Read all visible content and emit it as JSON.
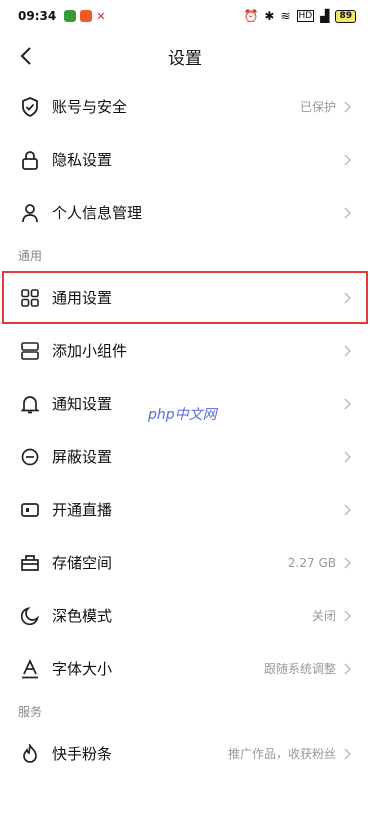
{
  "status": {
    "time": "09:34",
    "battery": "89"
  },
  "header": {
    "title": "设置"
  },
  "account": [
    {
      "label": "账号与安全",
      "value": "已保护"
    },
    {
      "label": "隐私设置",
      "value": ""
    },
    {
      "label": "个人信息管理",
      "value": ""
    }
  ],
  "general_section": "通用",
  "general": [
    {
      "label": "通用设置",
      "value": ""
    },
    {
      "label": "添加小组件",
      "value": ""
    },
    {
      "label": "通知设置",
      "value": ""
    },
    {
      "label": "屏蔽设置",
      "value": ""
    },
    {
      "label": "开通直播",
      "value": ""
    },
    {
      "label": "存储空间",
      "value": "2.27 GB"
    },
    {
      "label": "深色模式",
      "value": "关闭"
    },
    {
      "label": "字体大小",
      "value": "跟随系统调整"
    }
  ],
  "services_section": "服务",
  "services": [
    {
      "label": "快手粉条",
      "value": "推广作品，收获粉丝"
    }
  ],
  "watermark": "php中文网",
  "colors": {
    "highlight": "#e23b3b",
    "text": "#111111",
    "muted": "#999999"
  }
}
